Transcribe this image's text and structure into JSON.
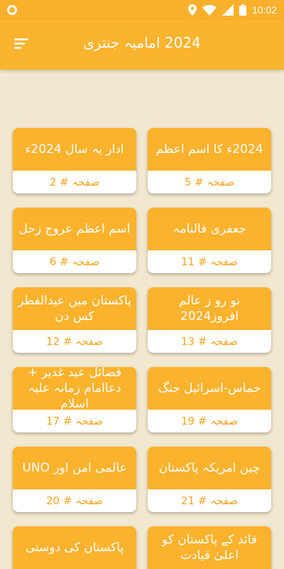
{
  "status_bar": {
    "time": "10:02",
    "icons": [
      "circle-notification-icon",
      "location-icon",
      "wifi-icon",
      "signal-icon",
      "battery-icon"
    ]
  },
  "app_bar": {
    "title": "2024 امامیہ جنتری",
    "menu_icon": "menu-lines-icon"
  },
  "colors": {
    "accent": "#fab42e",
    "background": "#f2e8cf",
    "page_label": "#f5a623"
  },
  "cards": [
    {
      "title": "ادار یہ سال 2024ء",
      "page": "صفحہ # 2"
    },
    {
      "title": "2024ء کا اسم اعظم",
      "page": "صفحہ # 5"
    },
    {
      "title": "اسم اعظم عروج زحل",
      "page": "صفحہ # 6"
    },
    {
      "title": "جعفری فالنامہ",
      "page": "صفحہ # 11"
    },
    {
      "title": "پاکستان میں عیدالفطر کس دن",
      "page": "صفحہ # 12"
    },
    {
      "title": "نو رو ز عالم افروز2024",
      "page": "صفحہ # 13"
    },
    {
      "title": "فضائل عید غدیر + دعاامام زمانہ علیہ اسلام",
      "page": "صفحہ # 17"
    },
    {
      "title": "حماس-اسرائیل جنگ",
      "page": "صفحہ # 19"
    },
    {
      "title": "عالمی امن اور UNO",
      "page": "صفحہ # 20"
    },
    {
      "title": "چین امریکہ پاکستان",
      "page": "صفحہ # 21"
    },
    {
      "title": "پاکستان کی دوستی",
      "page": ""
    },
    {
      "title": "قائد کے پاکستان کو اعلیٰ قیادت",
      "page": ""
    }
  ]
}
